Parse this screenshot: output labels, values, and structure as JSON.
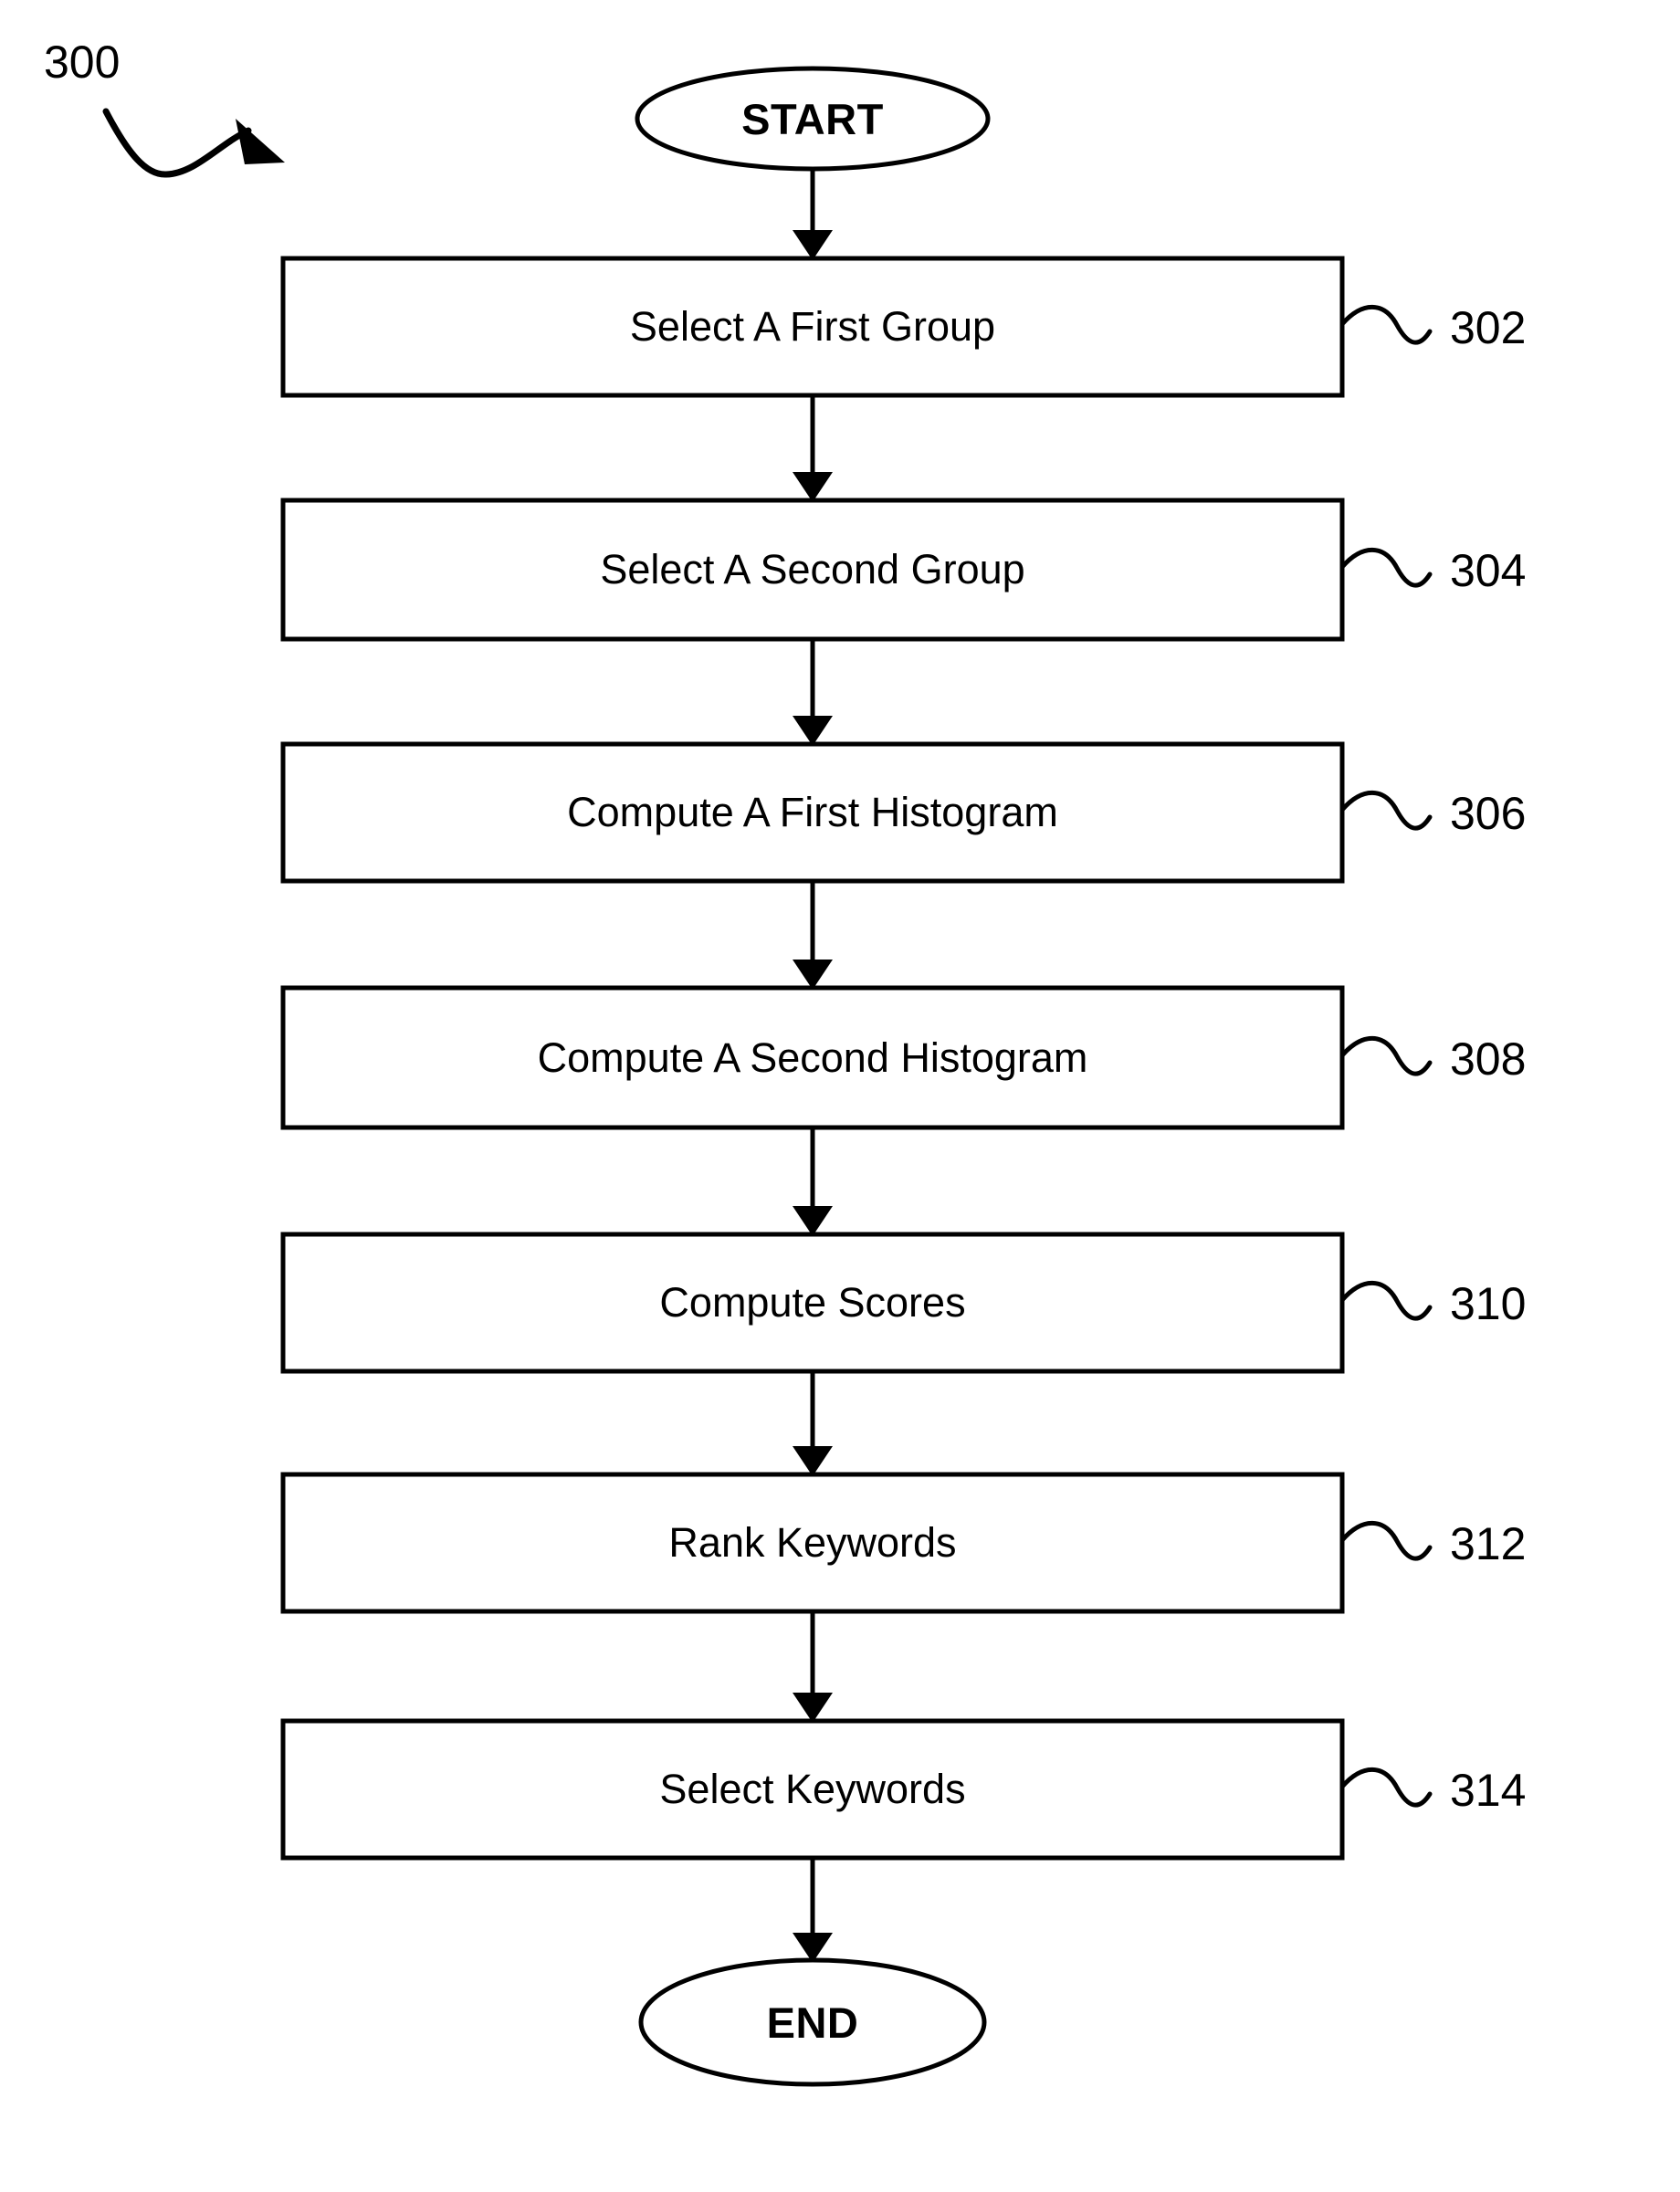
{
  "figure": {
    "figure_number": "300",
    "background_color": "#ffffff",
    "stroke_color": "#000000"
  },
  "nodes": [
    {
      "id": "start",
      "type": "terminator",
      "label": "START",
      "ref": ""
    },
    {
      "id": "step-302",
      "type": "process",
      "label": "Select A First Group",
      "ref": "302"
    },
    {
      "id": "step-304",
      "type": "process",
      "label": "Select A Second Group",
      "ref": "304"
    },
    {
      "id": "step-306",
      "type": "process",
      "label": "Compute A First Histogram",
      "ref": "306"
    },
    {
      "id": "step-308",
      "type": "process",
      "label": "Compute A Second Histogram",
      "ref": "308"
    },
    {
      "id": "step-310",
      "type": "process",
      "label": "Compute Scores",
      "ref": "310"
    },
    {
      "id": "step-312",
      "type": "process",
      "label": "Rank Keywords",
      "ref": "312"
    },
    {
      "id": "step-314",
      "type": "process",
      "label": "Select Keywords",
      "ref": "314"
    },
    {
      "id": "end",
      "type": "terminator",
      "label": "END",
      "ref": ""
    }
  ]
}
